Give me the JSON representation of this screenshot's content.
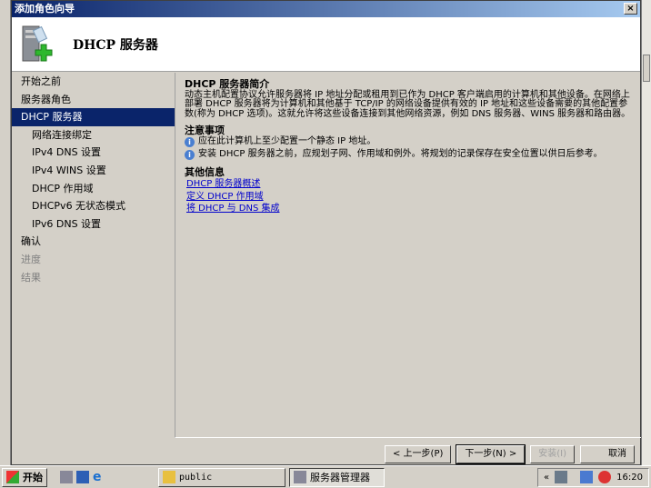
{
  "window": {
    "title": "添加角色向导",
    "close": "×"
  },
  "header": {
    "title": "DHCP 服务器"
  },
  "nav": [
    {
      "label": "开始之前",
      "state": "normal",
      "level": 0
    },
    {
      "label": "服务器角色",
      "state": "normal",
      "level": 0
    },
    {
      "label": "DHCP 服务器",
      "state": "selected",
      "level": 0
    },
    {
      "label": "网络连接绑定",
      "state": "normal",
      "level": 1
    },
    {
      "label": "IPv4 DNS 设置",
      "state": "normal",
      "level": 1
    },
    {
      "label": "IPv4 WINS 设置",
      "state": "normal",
      "level": 1
    },
    {
      "label": "DHCP 作用域",
      "state": "normal",
      "level": 1
    },
    {
      "label": "DHCPv6 无状态模式",
      "state": "normal",
      "level": 1
    },
    {
      "label": "IPv6 DNS 设置",
      "state": "normal",
      "level": 1
    },
    {
      "label": "确认",
      "state": "normal",
      "level": 0
    },
    {
      "label": "进度",
      "state": "disabled",
      "level": 0
    },
    {
      "label": "结果",
      "state": "disabled",
      "level": 0
    }
  ],
  "content": {
    "intro_heading": "DHCP 服务器简介",
    "intro_text": "动态主机配置协议允许服务器将 IP 地址分配或租用到已作为 DHCP 客户端启用的计算机和其他设备。在网络上部署 DHCP 服务器将为计算机和其他基于 TCP/IP 的网络设备提供有效的 IP 地址和这些设备需要的其他配置参数(称为 DHCP 选项)。这就允许将这些设备连接到其他网络资源，例如 DNS 服务器、WINS 服务器和路由器。",
    "notes_heading": "注意事项",
    "notes": [
      "应在此计算机上至少配置一个静态 IP 地址。",
      "安装 DHCP 服务器之前，应规划子网、作用域和例外。将规划的记录保存在安全位置以供日后参考。"
    ],
    "more_heading": "其他信息",
    "links": [
      "DHCP 服务器概述",
      "定义 DHCP 作用域",
      "将 DHCP 与 DNS 集成"
    ]
  },
  "buttons": {
    "prev": "< 上一步(P)",
    "next": "下一步(N) >",
    "install": "安装(I)",
    "cancel": "取消"
  },
  "taskbar": {
    "start": "开始",
    "items": [
      "public",
      "服务器管理器"
    ],
    "clock": "16:20"
  }
}
